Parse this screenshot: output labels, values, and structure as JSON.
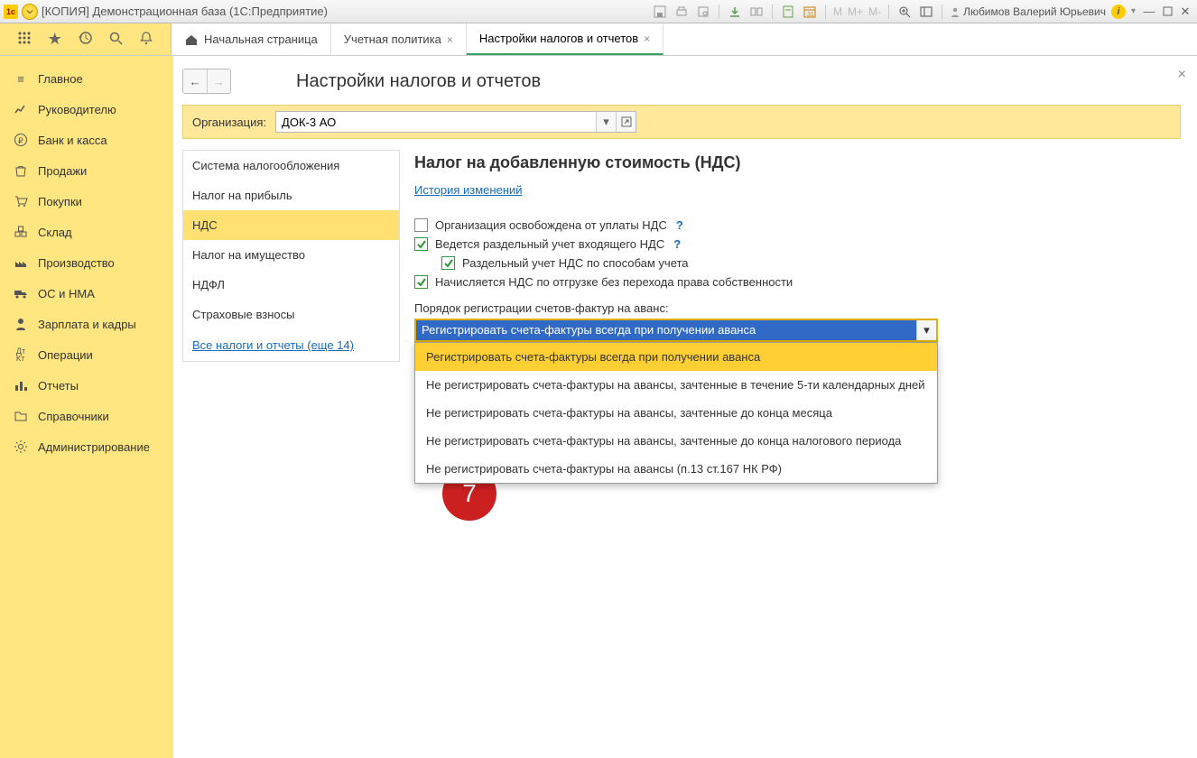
{
  "title": "[КОПИЯ] Демонстрационная база  (1С:Предприятие)",
  "user": "Любимов Валерий Юрьевич",
  "m_labels": [
    "M",
    "M+",
    "M-"
  ],
  "tabs": {
    "home_label": "Начальная страница",
    "t1": "Учетная политика",
    "t2": "Настройки налогов и отчетов"
  },
  "sidebar": {
    "items": [
      {
        "label": "Главное"
      },
      {
        "label": "Руководителю"
      },
      {
        "label": "Банк и касса"
      },
      {
        "label": "Продажи"
      },
      {
        "label": "Покупки"
      },
      {
        "label": "Склад"
      },
      {
        "label": "Производство"
      },
      {
        "label": "ОС и НМА"
      },
      {
        "label": "Зарплата и кадры"
      },
      {
        "label": "Операции"
      },
      {
        "label": "Отчеты"
      },
      {
        "label": "Справочники"
      },
      {
        "label": "Администрирование"
      }
    ]
  },
  "page": {
    "title": "Настройки налогов и отчетов",
    "org_label": "Организация:",
    "org_value": "ДОК-3 АО"
  },
  "settings_nav": {
    "items": [
      "Система налогообложения",
      "Налог на прибыль",
      "НДС",
      "Налог на имущество",
      "НДФЛ",
      "Страховые взносы"
    ],
    "all_link": "Все налоги и отчеты (еще 14)"
  },
  "panel": {
    "heading": "Налог на добавленную стоимость (НДС)",
    "history": "История изменений",
    "chk1": "Организация освобождена от уплаты НДС",
    "chk2": "Ведется раздельный учет входящего НДС",
    "chk2a": "Раздельный учет НДС по способам учета",
    "chk3": "Начисляется НДС по отгрузке без перехода права собственности",
    "field_label": "Порядок регистрации счетов-фактур на аванс:",
    "select_value": "Регистрировать счета-фактуры всегда при получении аванса",
    "options": [
      "Регистрировать счета-фактуры всегда при получении аванса",
      "Не регистрировать счета-фактуры на авансы, зачтенные в течение 5-ти календарных дней",
      "Не регистрировать счета-фактуры на авансы, зачтенные до конца месяца",
      "Не регистрировать счета-фактуры на авансы, зачтенные до конца налогового периода",
      "Не регистрировать счета-фактуры на авансы (п.13 ст.167 НК РФ)"
    ]
  },
  "annotation": {
    "num": "7"
  }
}
